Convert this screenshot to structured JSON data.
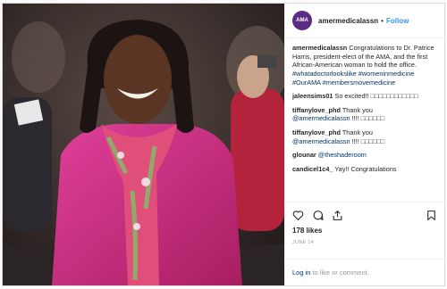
{
  "post": {
    "avatar_text": "AMA",
    "username": "amermedicalassn",
    "separator": "•",
    "follow_label": "Follow"
  },
  "caption": {
    "username": "amermedicalassn",
    "text": "Congratulations to Dr. Patrice Harris, president-elect of the AMA, and the first African-American woman to hold the office.",
    "hashtags": "#whatadoctorlookslike #womeninmedicine #OurAMA #membersmovemedicine"
  },
  "comments": [
    {
      "user": "jaleensims01",
      "text": "So excited!! ",
      "emoji": "□□□□□□□□□□□□"
    },
    {
      "user": "tiffanylove_phd",
      "text": "Thank you",
      "mention": "@amermedicalassn",
      "tail": "!!!! □□□□□□"
    },
    {
      "user": "tiffanylove_phd",
      "text": "Thank you",
      "mention": "@amermedicalassn",
      "tail": "!!!! □□□□□□"
    },
    {
      "user": "glounar",
      "mention": "@theshaderoom"
    },
    {
      "user": "candicel1c4_",
      "text": "Yay!! Congratulations"
    }
  ],
  "icons": [
    "heart-icon",
    "comment-icon",
    "share-icon",
    "bookmark-icon"
  ],
  "likes": "178 likes",
  "date": "JUNE 14",
  "login": {
    "link": "Log in",
    "rest": "to like or comment."
  },
  "colors": {
    "accent": "#3897f0",
    "jacket": "#cc2a7a",
    "avatar": "#5b2d82"
  }
}
